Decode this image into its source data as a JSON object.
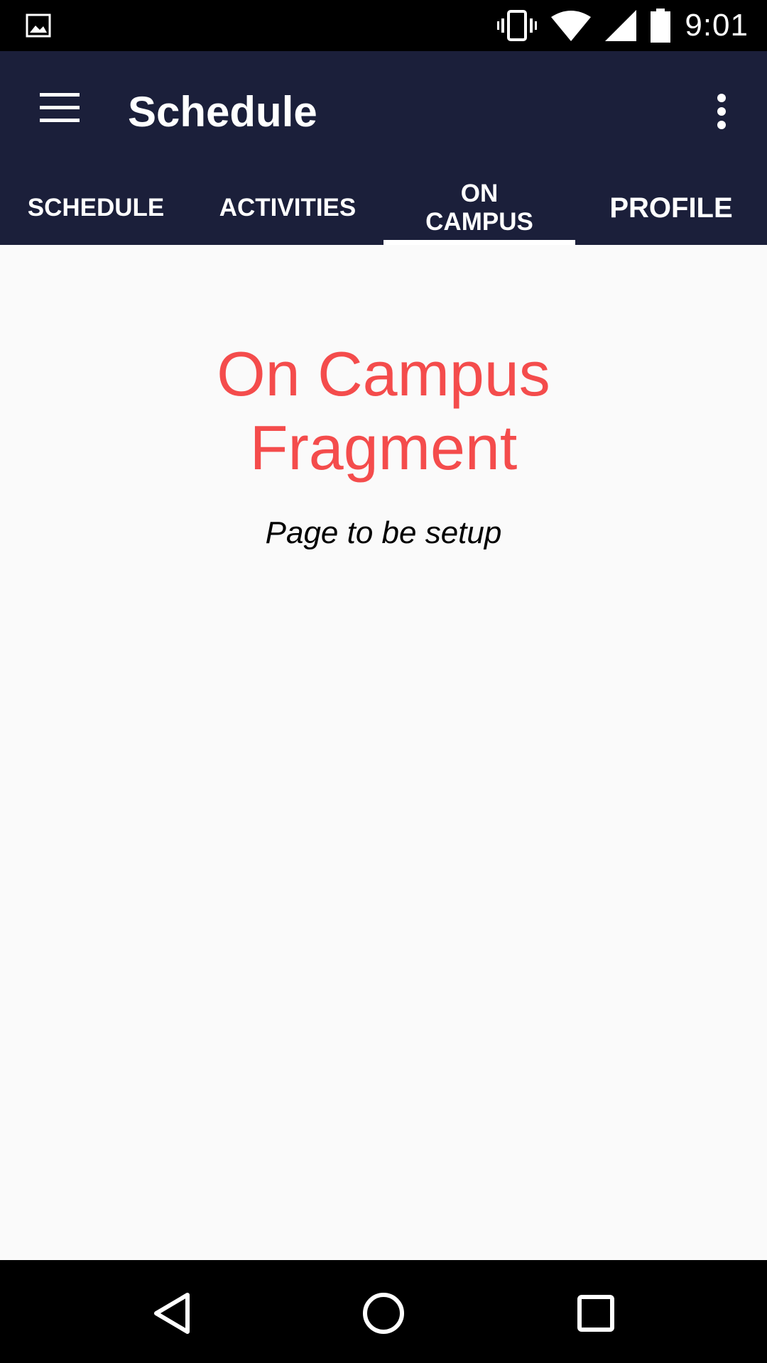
{
  "status_bar": {
    "time": "9:01",
    "icons": [
      "gallery-icon",
      "vibrate-icon",
      "wifi-icon",
      "signal-icon",
      "battery-icon"
    ]
  },
  "app_bar": {
    "title": "Schedule",
    "background_color": "#1b1f3a",
    "menu_icon": "hamburger-menu-icon",
    "overflow_icon": "more-vert-icon"
  },
  "tabs": [
    {
      "label": "SCHEDULE",
      "active": false
    },
    {
      "label": "ACTIVITIES",
      "active": false
    },
    {
      "label": "ON\nCAMPUS",
      "active": true
    },
    {
      "label": "PROFILE",
      "active": false
    }
  ],
  "content": {
    "heading": "On Campus\nFragment",
    "heading_color": "#f44c4c",
    "subtext": "Page to be setup"
  },
  "nav_bar": {
    "icons": [
      "back-icon",
      "home-icon",
      "recents-icon"
    ]
  }
}
